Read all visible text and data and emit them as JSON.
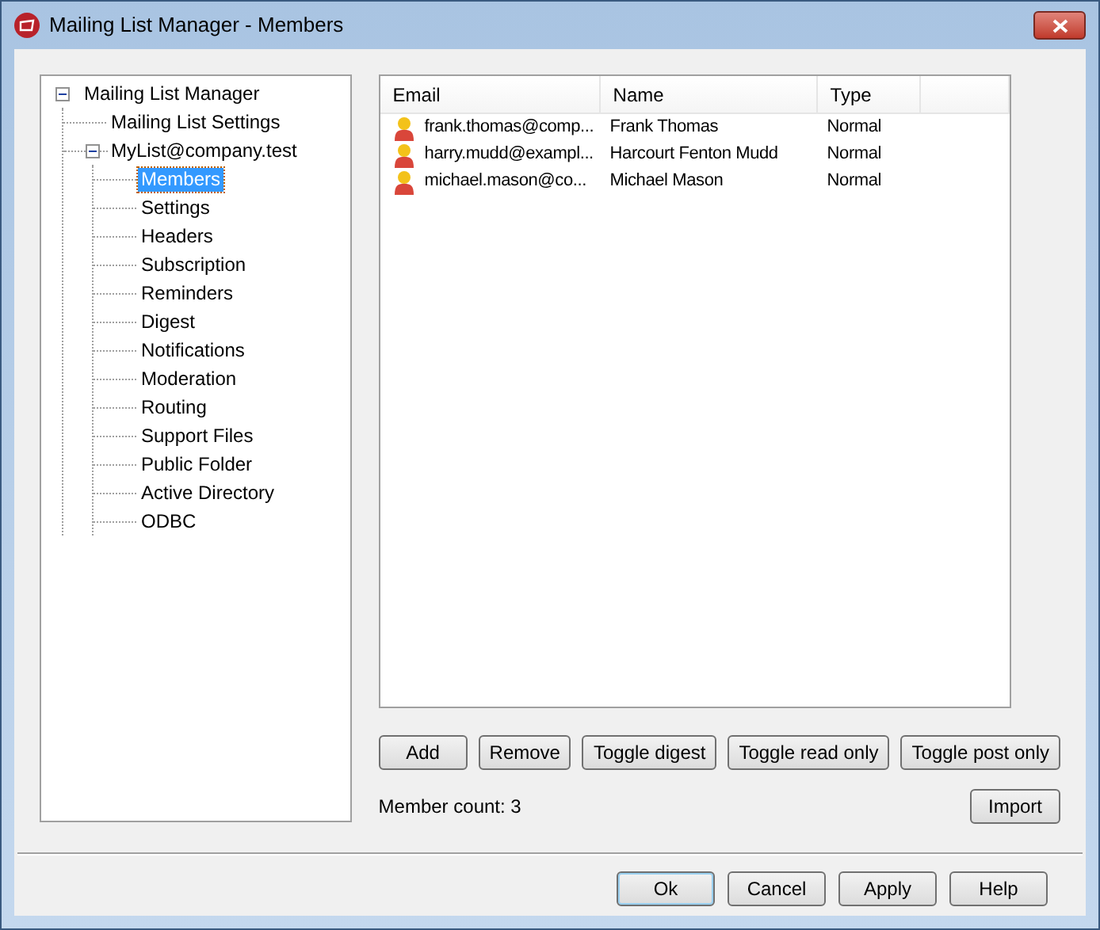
{
  "window": {
    "title": "Mailing List Manager - Members"
  },
  "tree": [
    {
      "label": "Mailing List Manager",
      "expanded": true,
      "selected": false,
      "children": [
        {
          "label": "Mailing List Settings",
          "selected": false
        },
        {
          "label": "MyList@company.test",
          "expanded": true,
          "selected": false,
          "children": [
            {
              "label": "Members",
              "selected": true
            },
            {
              "label": "Settings",
              "selected": false
            },
            {
              "label": "Headers",
              "selected": false
            },
            {
              "label": "Subscription",
              "selected": false
            },
            {
              "label": "Reminders",
              "selected": false
            },
            {
              "label": "Digest",
              "selected": false
            },
            {
              "label": "Notifications",
              "selected": false
            },
            {
              "label": "Moderation",
              "selected": false
            },
            {
              "label": "Routing",
              "selected": false
            },
            {
              "label": "Support Files",
              "selected": false
            },
            {
              "label": "Public Folder",
              "selected": false
            },
            {
              "label": "Active Directory",
              "selected": false
            },
            {
              "label": "ODBC",
              "selected": false
            }
          ]
        }
      ]
    }
  ],
  "table": {
    "columns": [
      "Email",
      "Name",
      "Type"
    ],
    "rows": [
      [
        "frank.thomas@comp...",
        "Frank Thomas",
        "Normal"
      ],
      [
        "harry.mudd@exampl...",
        "Harcourt Fenton Mudd",
        "Normal"
      ],
      [
        "michael.mason@co...",
        "Michael Mason",
        "Normal"
      ]
    ]
  },
  "member_buttons": [
    "Add",
    "Remove",
    "Toggle digest",
    "Toggle read only",
    "Toggle post only"
  ],
  "member_count": "Member count: 3",
  "import_button": "Import",
  "dialog_buttons": [
    {
      "label": "Ok",
      "default": true
    },
    {
      "label": "Cancel",
      "default": false
    },
    {
      "label": "Apply",
      "default": false
    },
    {
      "label": "Help",
      "default": false
    }
  ]
}
